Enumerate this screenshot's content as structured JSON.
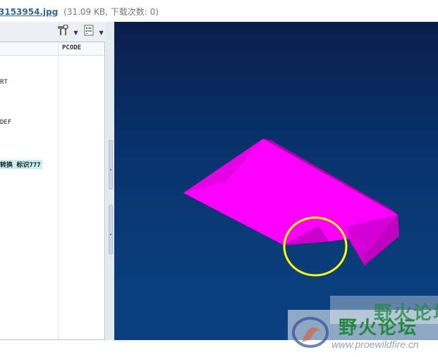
{
  "caption": {
    "file_name": "3153954.jpg",
    "file_meta": "(31.09 KB, 下载次数: 0)"
  },
  "toolbar": {
    "tools_icon": "hammer-wrench-icon",
    "settings_icon": "list-settings-icon"
  },
  "tree": {
    "column_header": "PCODE",
    "items": [
      {
        "label": "RT"
      },
      {
        "label": "DEF"
      },
      {
        "label": "转换 标识777"
      }
    ]
  },
  "viewport": {
    "background_top": "#0b1e4a",
    "background_bottom": "#0b3f80",
    "part_color": "#ff00ff",
    "highlight_circle_color": "#ffff00"
  },
  "watermark": {
    "title": "野火论坛",
    "title_partial": "野火论坛",
    "url": "www.proewildfire.cn",
    "text_color": "#1f8a3a"
  }
}
